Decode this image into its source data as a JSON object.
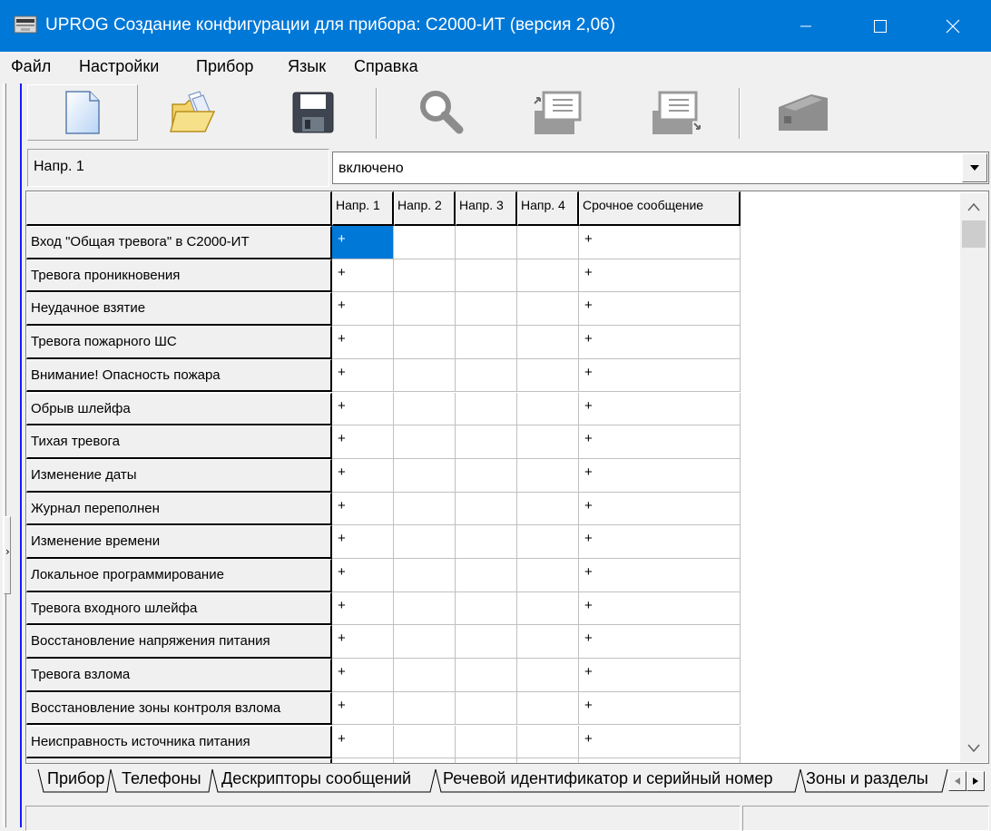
{
  "window": {
    "title": "UPROG  Создание конфигурации для прибора: С2000-ИТ (версия  2,06)",
    "title_bar_color": "#0078d7"
  },
  "menu": {
    "items": [
      "Файл",
      "Настройки",
      "Прибор",
      "Язык",
      "Справка"
    ]
  },
  "toolbar": {
    "buttons": [
      "new-document-icon",
      "open-folder-icon",
      "save-disk-icon",
      "search-magnifier-icon",
      "read-config-icon",
      "write-config-icon",
      "device-icon"
    ]
  },
  "selector": {
    "label": "Напр. 1",
    "value": "включено"
  },
  "grid": {
    "columns": [
      "Напр. 1",
      "Напр. 2",
      "Напр. 3",
      "Напр. 4",
      "Срочное сообщение"
    ],
    "rows": [
      {
        "label": "Вход \"Общая тревога\" в С2000-ИТ",
        "values": [
          "+",
          "",
          "",
          "",
          "+"
        ]
      },
      {
        "label": "Тревога проникновения",
        "values": [
          "+",
          "",
          "",
          "",
          "+"
        ]
      },
      {
        "label": "Неудачное взятие",
        "values": [
          "+",
          "",
          "",
          "",
          "+"
        ]
      },
      {
        "label": "Тревога пожарного ШС",
        "values": [
          "+",
          "",
          "",
          "",
          "+"
        ]
      },
      {
        "label": "Внимание! Опасность пожара",
        "values": [
          "+",
          "",
          "",
          "",
          "+"
        ]
      },
      {
        "label": "Обрыв шлейфа",
        "values": [
          "+",
          "",
          "",
          "",
          "+"
        ]
      },
      {
        "label": "Тихая тревога",
        "values": [
          "+",
          "",
          "",
          "",
          "+"
        ]
      },
      {
        "label": "Изменение даты",
        "values": [
          "+",
          "",
          "",
          "",
          "+"
        ]
      },
      {
        "label": "Журнал переполнен",
        "values": [
          "+",
          "",
          "",
          "",
          "+"
        ]
      },
      {
        "label": "Изменение времени",
        "values": [
          "+",
          "",
          "",
          "",
          "+"
        ]
      },
      {
        "label": "Локальное программирование",
        "values": [
          "+",
          "",
          "",
          "",
          "+"
        ]
      },
      {
        "label": "Тревога входного шлейфа",
        "values": [
          "+",
          "",
          "",
          "",
          "+"
        ]
      },
      {
        "label": "Восстановление напряжения питания",
        "values": [
          "+",
          "",
          "",
          "",
          "+"
        ]
      },
      {
        "label": "Тревога взлома",
        "values": [
          "+",
          "",
          "",
          "",
          "+"
        ]
      },
      {
        "label": "Восстановление зоны контроля взлома",
        "values": [
          "+",
          "",
          "",
          "",
          "+"
        ]
      },
      {
        "label": "Неисправность источника питания",
        "values": [
          "+",
          "",
          "",
          "",
          "+"
        ]
      }
    ],
    "selection_color": "#0078d7"
  },
  "tabs": {
    "items": [
      "Прибор",
      "Телефоны",
      "Дескрипторы сообщений",
      "Речевой идентификатор и серийный номер",
      "Зоны и разделы"
    ],
    "active": "Дескрипторы сообщений"
  }
}
